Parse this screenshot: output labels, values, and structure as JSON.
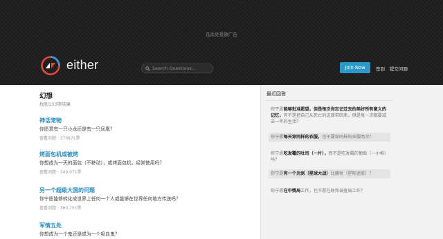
{
  "header": {
    "ad_text": "在此处投放广告",
    "brand": "either",
    "search_placeholder": "Search Questions...",
    "join_label": "Join Now",
    "signin_label": "签到",
    "submit_label": "提交问题",
    "accent_color": "#2a9bc9",
    "logo_colors": [
      "#e8463a",
      "#3aa0d8"
    ]
  },
  "main": {
    "title": "幻想",
    "result_count": "找到133项结果",
    "questions": [
      {
        "title": "神话宠物",
        "subtitle": "你愿意有一只小龙还是有一只凤凰？",
        "meta": "查看问题 · 370871票"
      },
      {
        "title": "烤面包机或被烤",
        "subtitle": "你想成为一天的面包（不移动），或烤面包机，经常使用吗？",
        "meta": "查看问题 · 349,071票"
      },
      {
        "title": "另一个超级大国的问题",
        "subtitle": "你宁愿能够转化成世界上任何一个人或能够在世界任何地方传送吗？",
        "meta": "查看问题 · 360,751票"
      },
      {
        "title": "军情五处",
        "subtitle": "你想成为一个鬼还是成为一个吸血鬼？",
        "meta": ""
      }
    ]
  },
  "sidebar": {
    "title": "最近回答",
    "items": [
      {
        "prefix": "你宁愿",
        "bold": "能够批准愿望，但是每次你忘记过去的美好所有意义的记忆，",
        "rest": "有不是把自己从死亡的边缘带回来，但是每一次都要减去一年的生活？"
      },
      {
        "prefix": "你宁愿",
        "bold": "每天穿同样的衣服，",
        "rest": "也不要穿同样的衣服两次？"
      },
      {
        "prefix": "你宁愿",
        "bold": "吃发霉的吐司（一片），",
        "rest": "而不是吃发霉的葡萄（一小堆）吗？"
      },
      {
        "prefix": "你宁愿",
        "bold": "有一个光剑（星球大战）",
        "rest": "比魔杖（星际迷航）？"
      },
      {
        "prefix": "你宁愿",
        "bold": "在中情局",
        "rest": "工作，也不愿在联邦调查局工作？"
      }
    ]
  }
}
